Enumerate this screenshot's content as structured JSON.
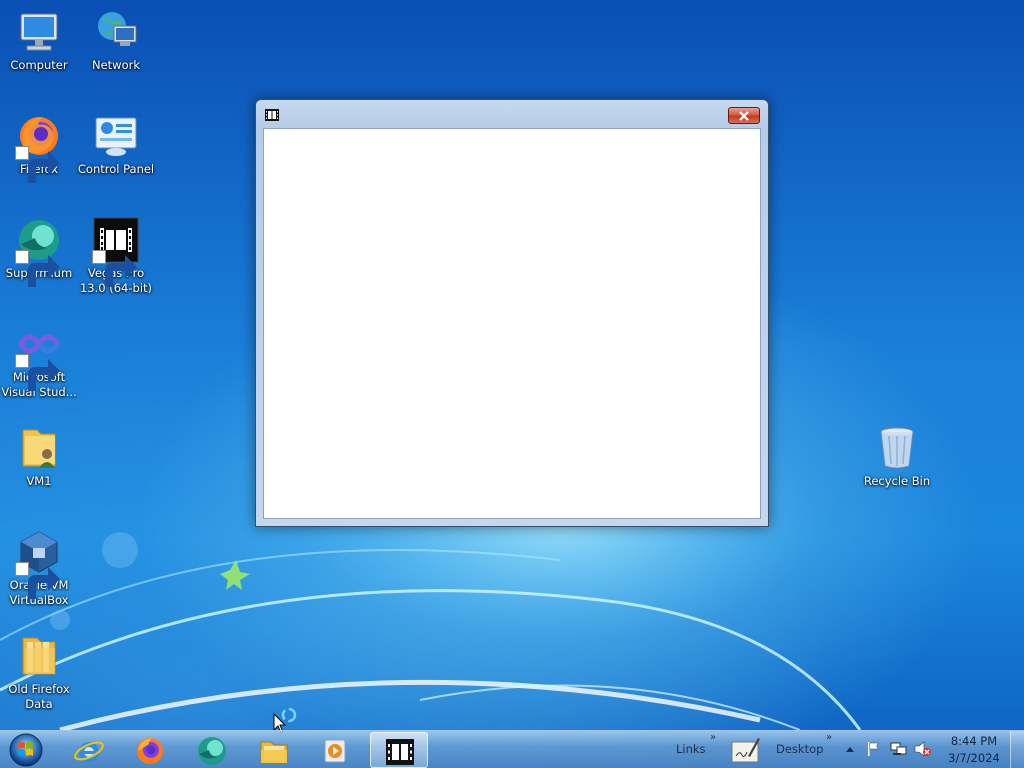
{
  "desktop": {
    "icons": [
      {
        "label": "Computer",
        "icon": "computer-icon"
      },
      {
        "label": "Network",
        "icon": "network-icon"
      },
      {
        "label": "Firefox",
        "icon": "firefox-icon"
      },
      {
        "label": "Control Panel",
        "icon": "control-panel-icon"
      },
      {
        "label": "Supermium",
        "icon": "supermium-icon"
      },
      {
        "label": "Vegas Pro 13.0 (64-bit)",
        "icon": "vegas-pro-icon"
      },
      {
        "label": "Microsoft Visual Stud...",
        "icon": "visual-studio-icon"
      },
      {
        "label": "VM1",
        "icon": "folder-user-icon"
      },
      {
        "label": "Oracle VM VirtualBox",
        "icon": "virtualbox-icon"
      },
      {
        "label": "Old Firefox Data",
        "icon": "folder-icon"
      },
      {
        "label": "Recycle Bin",
        "icon": "recycle-bin-icon"
      }
    ]
  },
  "window": {
    "title": "",
    "icon": "film-strip-icon",
    "close_icon": "close-icon"
  },
  "taskbar": {
    "start_icon": "windows-start-orb-icon",
    "pinned": [
      {
        "name": "Internet Explorer",
        "icon": "internet-explorer-icon"
      },
      {
        "name": "Firefox",
        "icon": "firefox-icon"
      },
      {
        "name": "Supermium",
        "icon": "supermium-icon"
      },
      {
        "name": "File Explorer",
        "icon": "file-explorer-icon"
      },
      {
        "name": "Media Player",
        "icon": "media-player-icon"
      },
      {
        "name": "Vegas Pro",
        "icon": "film-strip-icon",
        "active": true
      }
    ],
    "toolbars": {
      "links_label": "Links",
      "desktop_label": "Desktop",
      "chevron": "»"
    },
    "tray": {
      "show_hidden_icon": "up-arrow-icon",
      "icons": [
        "action-center-flag-icon",
        "network-icon",
        "volume-muted-icon"
      ]
    },
    "clock": {
      "time": "8:44 PM",
      "date": "3/7/2024"
    }
  },
  "colors": {
    "desktop_blue": "#1a7fd8",
    "close_red": "#c23b22",
    "window_frame": "#c6d9ee"
  }
}
